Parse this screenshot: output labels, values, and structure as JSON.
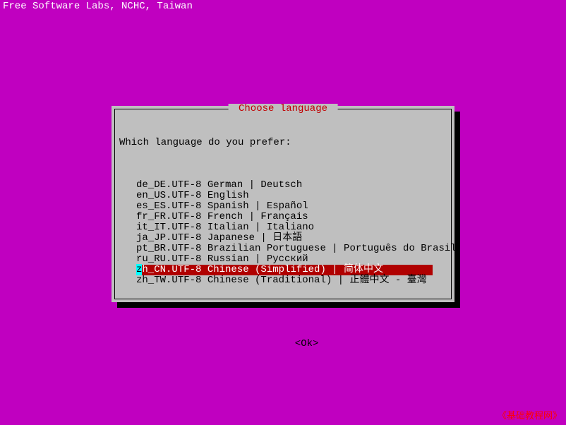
{
  "header": "Free Software Labs, NCHC, Taiwan",
  "dialog": {
    "title": " Choose language ",
    "prompt": "Which language do you prefer:",
    "items": [
      "de_DE.UTF-8 German | Deutsch",
      "en_US.UTF-8 English",
      "es_ES.UTF-8 Spanish | Español",
      "fr_FR.UTF-8 French | Français",
      "it_IT.UTF-8 Italian | Italiano",
      "ja_JP.UTF-8 Japanese | 日本語",
      "pt_BR.UTF-8 Brazilian Portuguese | Português do Brasil",
      "ru_RU.UTF-8 Russian | Русский",
      "zh_CN.UTF-8 Chinese (Simplified) | 简体中文",
      "zh_TW.UTF-8 Chinese (Traditional) | 正體中文 - 臺灣"
    ],
    "selected_index": 8,
    "ok_label": "<Ok>"
  },
  "footer": "《基础教程网》"
}
